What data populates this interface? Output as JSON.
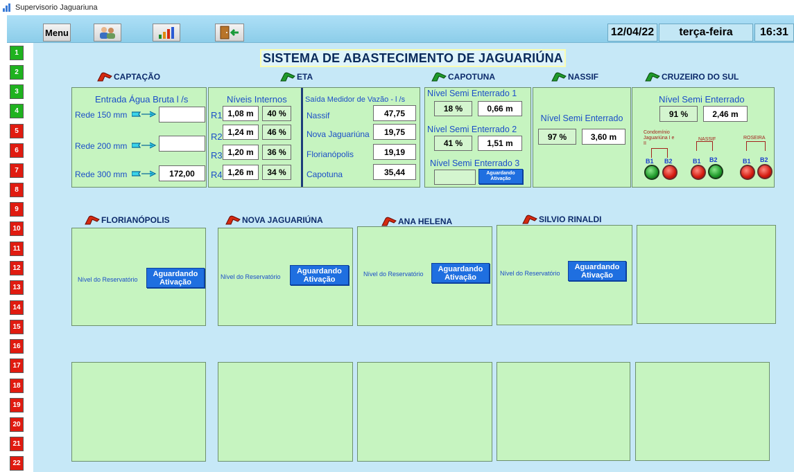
{
  "window": {
    "title": "Supervisorio Jaguariuna"
  },
  "toolbar": {
    "menu_label": "Menu",
    "icons": [
      "users-icon",
      "bar-chart-icon",
      "exit-door-icon"
    ],
    "date": "12/04/22",
    "weekday": "terça-feira",
    "time": "16:31"
  },
  "sidebar": {
    "items": [
      {
        "label": "1",
        "status": "green"
      },
      {
        "label": "2",
        "status": "green"
      },
      {
        "label": "3",
        "status": "green"
      },
      {
        "label": "4",
        "status": "green"
      },
      {
        "label": "5",
        "status": "red"
      },
      {
        "label": "6",
        "status": "red"
      },
      {
        "label": "7",
        "status": "red"
      },
      {
        "label": "8",
        "status": "red"
      },
      {
        "label": "9",
        "status": "red"
      },
      {
        "label": "10",
        "status": "red"
      },
      {
        "label": "11",
        "status": "red"
      },
      {
        "label": "12",
        "status": "red"
      },
      {
        "label": "13",
        "status": "red"
      },
      {
        "label": "14",
        "status": "red"
      },
      {
        "label": "15",
        "status": "red"
      },
      {
        "label": "16",
        "status": "red"
      },
      {
        "label": "17",
        "status": "red"
      },
      {
        "label": "18",
        "status": "red"
      },
      {
        "label": "19",
        "status": "red"
      },
      {
        "label": "20",
        "status": "red"
      },
      {
        "label": "21",
        "status": "red"
      },
      {
        "label": "22",
        "status": "red"
      }
    ],
    "colors": {
      "green": "#1fb21f",
      "red": "#e01b10"
    }
  },
  "main": {
    "title": "SISTEMA DE ABASTECIMENTO DE JAGUARIÚNA",
    "captacao": {
      "title": "CAPTAÇÃO",
      "subtitle": "Entrada Água Bruta l /s",
      "rows": [
        {
          "label": "Rede 150 mm",
          "value": ""
        },
        {
          "label": "Rede 200 mm",
          "value": ""
        },
        {
          "label": "Rede 300 mm",
          "value": "172,00"
        }
      ]
    },
    "eta": {
      "title": "ETA",
      "niveis_title": "Níveis Internos",
      "niveis": [
        {
          "label": "R1",
          "value": "1,08 m",
          "pct": "40 %"
        },
        {
          "label": "R2",
          "value": "1,24 m",
          "pct": "46 %"
        },
        {
          "label": "R3",
          "value": "1,20 m",
          "pct": "36 %"
        },
        {
          "label": "R4",
          "value": "1,26 m",
          "pct": "34 %"
        }
      ],
      "saida_title": "Saída Medidor de Vazão - l /s",
      "saida": [
        {
          "label": "Nassif",
          "value": "47,75"
        },
        {
          "label": "Nova Jaguariúna",
          "value": "19,75"
        },
        {
          "label": "Florianópolis",
          "value": "19,19"
        },
        {
          "label": "Capotuna",
          "value": "35,44"
        }
      ]
    },
    "capotuna": {
      "title": "CAPOTUNA",
      "items": [
        {
          "label": "Nível Semi Enterrado 1",
          "pct": "18 %",
          "value": "0,66 m"
        },
        {
          "label": "Nível Semi Enterrado 2",
          "pct": "41 %",
          "value": "1,51 m"
        },
        {
          "label": "Nível Semi Enterrado 3",
          "pct": "",
          "button": "Aguardando Ativação"
        }
      ]
    },
    "nassif": {
      "title": "NASSIF",
      "label": "Nível Semi Enterrado",
      "pct": "97 %",
      "value": "3,60 m"
    },
    "cruzeiro": {
      "title": "CRUZEIRO DO SUL",
      "label": "Nível Semi Enterrado",
      "pct": "91 %",
      "value": "2,46 m",
      "groups": [
        {
          "label": "Condomínio Jaguariúna I e II",
          "pumps": [
            {
              "name": "B1",
              "state": "green"
            },
            {
              "name": "B2",
              "state": "red"
            }
          ]
        },
        {
          "label": "NASSIF",
          "pumps": [
            {
              "name": "B1",
              "state": "red"
            },
            {
              "name": "B2",
              "state": "green"
            }
          ]
        },
        {
          "label": "ROSEIRA",
          "pumps": [
            {
              "name": "B1",
              "state": "red"
            },
            {
              "name": "B2",
              "state": "red"
            }
          ]
        }
      ]
    },
    "reservoirs": [
      {
        "title": "FLORIANÓPOLIS",
        "label": "Nível do Reservatório",
        "button": "Aguardando Ativação"
      },
      {
        "title": "NOVA JAGUARIÚNA",
        "label": "Nível do Reservatório",
        "button": "Aguardando Ativação"
      },
      {
        "title": "ANA HELENA",
        "label": "Nível do Reservatório",
        "button": "Aguardando Ativação"
      },
      {
        "title": "SILVIO RINALDI",
        "label": "Nível do Reservatório",
        "button": "Aguardando Ativação"
      }
    ]
  },
  "colors": {
    "background": "#c6e8f7",
    "panel": "#c6f4c0",
    "title_text": "#0a2a5a",
    "label_blue": "#1a4dc8",
    "button_blue": "#1f6fe0"
  }
}
